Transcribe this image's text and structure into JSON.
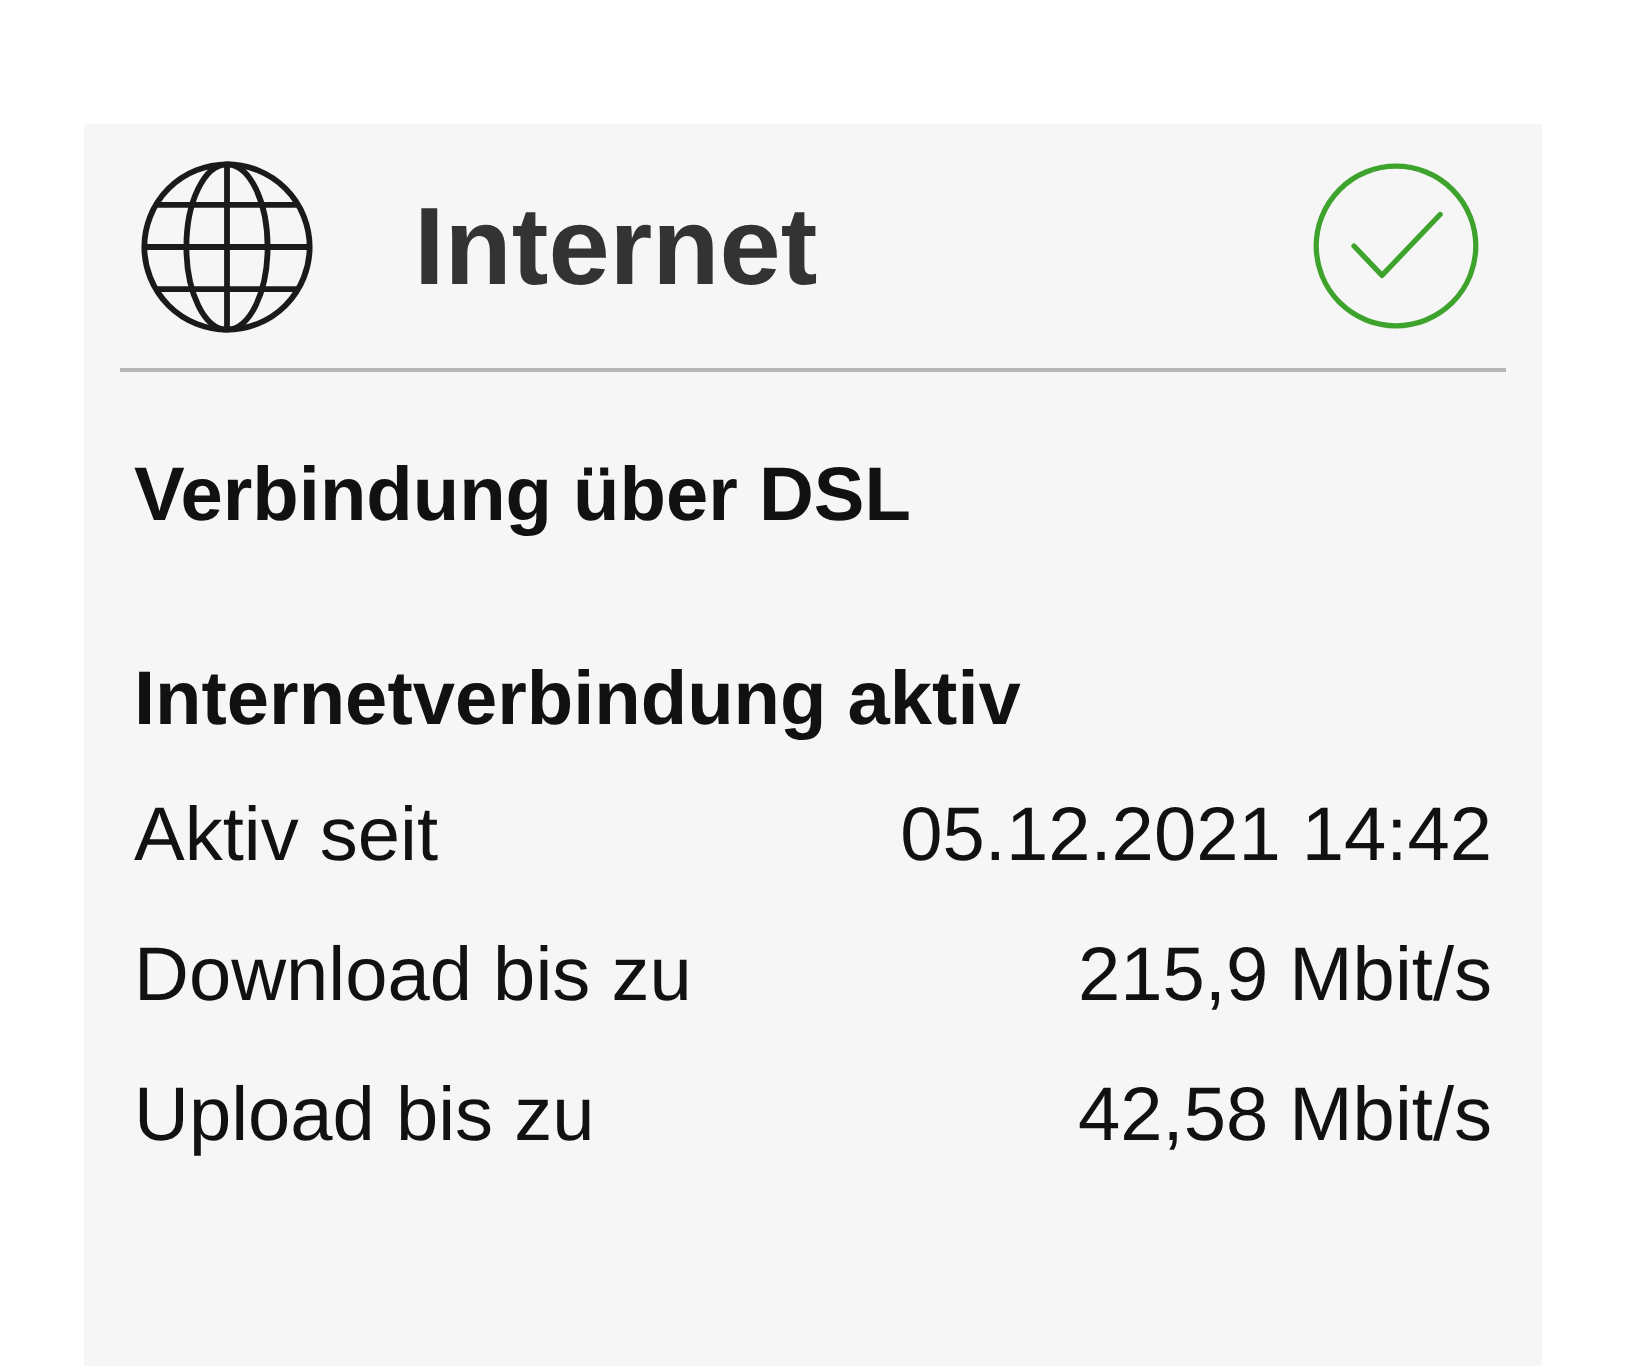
{
  "card": {
    "title": "Internet",
    "connected": true
  },
  "connection_type": "Verbindung über DSL",
  "status": {
    "heading": "Internetverbindung aktiv",
    "rows": [
      {
        "label": "Aktiv seit",
        "value": "05.12.2021 14:42"
      },
      {
        "label": "Download bis zu",
        "value": "215,9 Mbit/s"
      },
      {
        "label": "Upload bis zu",
        "value": "42,58 Mbit/s"
      }
    ]
  }
}
